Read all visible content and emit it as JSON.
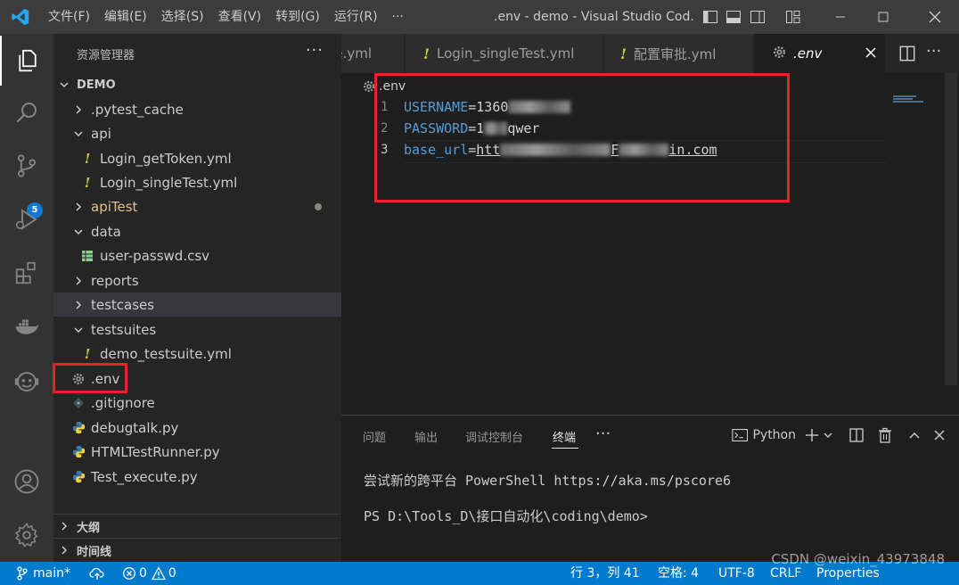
{
  "titlebar": {
    "menus": [
      "文件(F)",
      "编辑(E)",
      "选择(S)",
      "查看(V)",
      "转到(G)",
      "运行(R)"
    ],
    "more": "···",
    "title": ".env - demo - Visual Studio Cod..."
  },
  "activitybar": {
    "icons": [
      "explorer-icon",
      "search-icon",
      "source-control-icon",
      "run-debug-icon",
      "extensions-icon",
      "docker-icon",
      "remote-icon",
      "account-icon",
      "settings-gear-icon"
    ],
    "scm_badge": "5"
  },
  "sidebar": {
    "header": "资源管理器",
    "more": "···",
    "project": "DEMO",
    "tree": [
      {
        "label": ".pytest_cache",
        "kind": "folder",
        "expanded": false
      },
      {
        "label": "api",
        "kind": "folder",
        "expanded": true
      },
      {
        "label": "Login_getToken.yml",
        "kind": "yml"
      },
      {
        "label": "Login_singleTest.yml",
        "kind": "yml"
      },
      {
        "label": "apiTest",
        "kind": "folder",
        "expanded": false,
        "modified": true
      },
      {
        "label": "data",
        "kind": "folder",
        "expanded": true
      },
      {
        "label": "user-passwd.csv",
        "kind": "csv"
      },
      {
        "label": "reports",
        "kind": "folder",
        "expanded": false
      },
      {
        "label": "testcases",
        "kind": "folder",
        "expanded": false,
        "selected": true
      },
      {
        "label": "testsuites",
        "kind": "folder",
        "expanded": true
      },
      {
        "label": "demo_testsuite.yml",
        "kind": "yml"
      },
      {
        "label": ".env",
        "kind": "env"
      },
      {
        "label": ".gitignore",
        "kind": "git"
      },
      {
        "label": "debugtalk.py",
        "kind": "py"
      },
      {
        "label": "HTMLTestRunner.py",
        "kind": "py"
      },
      {
        "label": "Test_execute.py",
        "kind": "py"
      }
    ],
    "outline": "大纲",
    "timeline": "时间线"
  },
  "tabs": [
    {
      "label": "e.yml",
      "icon": ""
    },
    {
      "label": "Login_singleTest.yml",
      "icon": "!"
    },
    {
      "label": "配置审批.yml",
      "icon": "!"
    },
    {
      "label": ".env",
      "icon": "gear",
      "active": true
    }
  ],
  "editor": {
    "breadcrumb": ".env",
    "lines": [
      {
        "num": "1",
        "key": "USERNAME",
        "eq": "=",
        "value": "1360"
      },
      {
        "num": "2",
        "key": "PASSWORD",
        "eq": "=",
        "value": "1",
        "value2": "qwer"
      },
      {
        "num": "3",
        "key": "base_url",
        "eq": "=",
        "value": "htt",
        "value2": "F",
        "value3": "in.com"
      }
    ]
  },
  "panel": {
    "tabs": [
      "问题",
      "输出",
      "调试控制台",
      "终端"
    ],
    "active_tab": "终端",
    "more": "···",
    "terminal_profile": "Python",
    "terminal_lines": [
      "尝试新的跨平台 PowerShell https://aka.ms/pscore6",
      "PS D:\\Tools_D\\接口自动化\\coding\\demo>"
    ]
  },
  "statusbar": {
    "branch": "main*",
    "errors": "0",
    "warnings": "0",
    "position": "行 3，列 41",
    "spaces": "空格: 4",
    "encoding": "UTF-8",
    "eol": "CRLF",
    "properties": "Properties"
  },
  "watermark": "CSDN @weixin_43973848",
  "colors": {
    "accent": "#007acc",
    "highlight": "#e8212a",
    "keyword": "#569cd6"
  }
}
